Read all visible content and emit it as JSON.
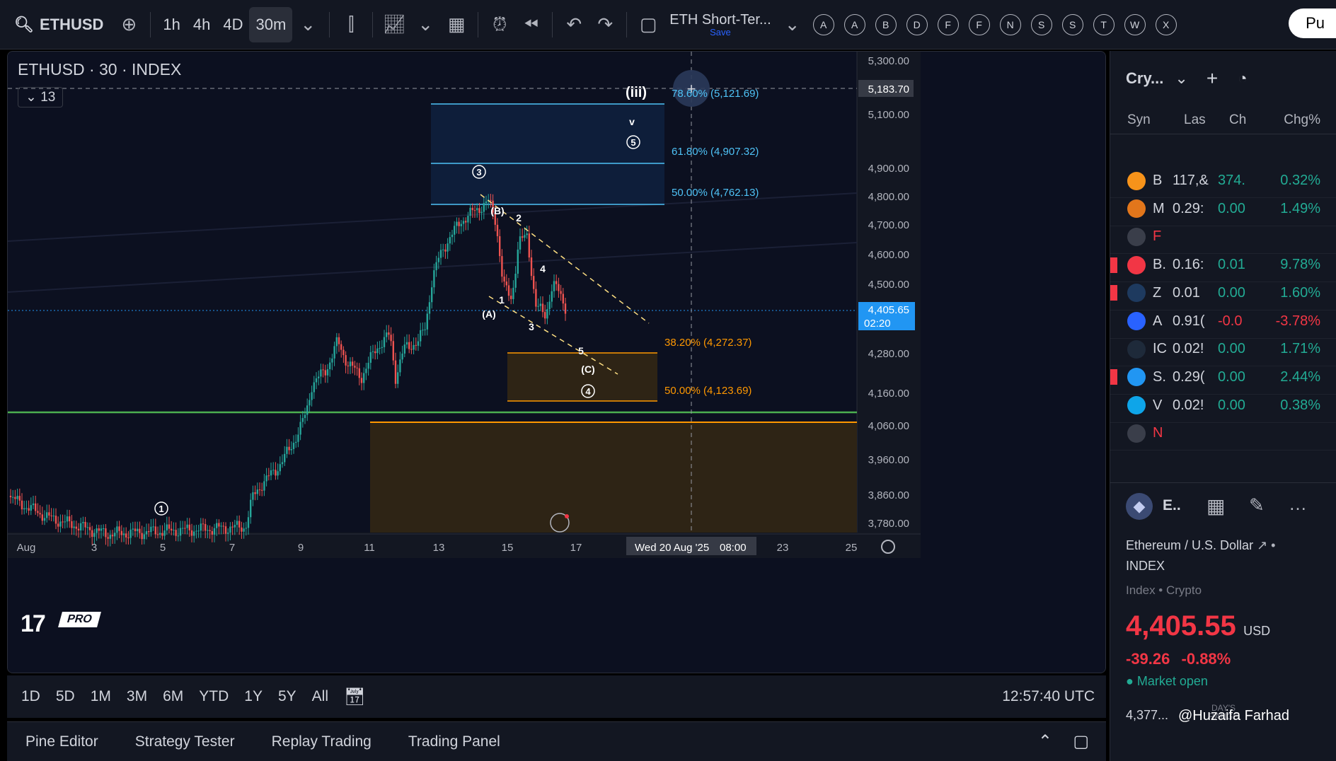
{
  "toolbar": {
    "symbol": "ETHUSD",
    "timeframes": [
      "1h",
      "4h",
      "4D",
      "30m"
    ],
    "active_timeframe": "30m",
    "layout_name": "ETH Short-Ter...",
    "layout_save": "Save",
    "letter_buttons": [
      "A",
      "A",
      "B",
      "D",
      "F",
      "F",
      "N",
      "S",
      "S",
      "T",
      "W",
      "X"
    ],
    "publish_label": "Pu",
    "icons": [
      "search-icon",
      "add-symbol-icon",
      "chevron-down-icon",
      "candles-icon",
      "indicators-icon",
      "layouts-icon",
      "alert-icon",
      "replay-icon",
      "undo-icon",
      "redo-icon",
      "fullscreen-icon"
    ]
  },
  "chart": {
    "title": "ETHUSD · 30 · INDEX",
    "indicator_count": "13",
    "logo_text": "PRO",
    "current_price": "4,405.65",
    "countdown": "02:20",
    "crosshair_price": "5,183.70",
    "crosshair_date": "Wed 20 Aug '25",
    "crosshair_time": "08:00",
    "price_ticks": [
      "5,300.00",
      "5,100.00",
      "4,900.00",
      "4,800.00",
      "4,700.00",
      "4,600.00",
      "4,500.00",
      "4,280.00",
      "4,160.00",
      "4,060.00",
      "3,960.00",
      "3,860.00",
      "3,780.00"
    ],
    "date_ticks": [
      "Aug",
      "3",
      "5",
      "7",
      "9",
      "11",
      "13",
      "15",
      "17",
      "23",
      "25"
    ],
    "fib_levels_upper": [
      "78.60% (5,121.69)",
      "61.80% (4,907.32)",
      "50.00% (4,762.13)"
    ],
    "fib_levels_lower": [
      "38.20% (4,272.37)",
      "50.00% (4,123.69)"
    ],
    "wave_labels": [
      "(iii)",
      "v",
      "5",
      "3",
      "(B)",
      "2",
      "4",
      "1",
      "(A)",
      "3",
      "5",
      "(C)",
      "4",
      "1"
    ],
    "colors": {
      "background": "#0c1020",
      "upper_zone": "#0f2140",
      "upper_line": "#4fc3f7",
      "lower_zone": "#2e2415",
      "lower_line": "#ff9800",
      "support_line": "#4caf50",
      "candle_up": "#26a69a",
      "candle_down": "#ef5350",
      "current_price_bg": "#2196f3"
    }
  },
  "range_bar": {
    "ranges": [
      "1D",
      "5D",
      "1M",
      "3M",
      "6M",
      "YTD",
      "1Y",
      "5Y",
      "All"
    ],
    "clock": "12:57:40 UTC"
  },
  "bottom_tabs": [
    "Pine Editor",
    "Strategy Tester",
    "Replay Trading",
    "Trading Panel"
  ],
  "watchlist": {
    "title": "Cry...",
    "columns": [
      "Syn",
      "Las",
      "Ch",
      "Chg%"
    ],
    "rows": [
      {
        "sym": "B",
        "last": "117,&",
        "ch": "374.",
        "chp": "0.32%",
        "dir": "pos",
        "icon_color": "#f7931a",
        "flag": false
      },
      {
        "sym": "M",
        "last": "0.29:",
        "ch": "0.00",
        "chp": "1.49%",
        "dir": "pos",
        "icon_color": "#e2761b",
        "flag": false
      },
      {
        "sym": "F",
        "last": "",
        "ch": "",
        "chp": "",
        "dir": "neg",
        "icon_color": "#3a3e4a",
        "flag": false
      },
      {
        "sym": "B.",
        "last": "0.16:",
        "ch": "0.01",
        "chp": "9.78%",
        "dir": "pos",
        "icon_color": "#f23645",
        "flag": true
      },
      {
        "sym": "Z",
        "last": "0.01",
        "ch": "0.00",
        "chp": "1.60%",
        "dir": "pos",
        "icon_color": "#1e3a5f",
        "flag": true
      },
      {
        "sym": "A",
        "last": "0.91(",
        "ch": "-0.0",
        "chp": "-3.78%",
        "dir": "neg",
        "icon_color": "#2962ff",
        "flag": false
      },
      {
        "sym": "IC",
        "last": "0.02!",
        "ch": "0.00",
        "chp": "1.71%",
        "dir": "pos",
        "icon_color": "#1e2a3a",
        "flag": false
      },
      {
        "sym": "S.",
        "last": "0.29(",
        "ch": "0.00",
        "chp": "2.44%",
        "dir": "pos",
        "icon_color": "#2196f3",
        "flag": true
      },
      {
        "sym": "V",
        "last": "0.02!",
        "ch": "0.00",
        "chp": "0.38%",
        "dir": "pos",
        "icon_color": "#0ea5e9",
        "flag": false
      },
      {
        "sym": "N",
        "last": "",
        "ch": "",
        "chp": "",
        "dir": "neg",
        "icon_color": "#3a3e4a",
        "flag": false
      }
    ]
  },
  "details": {
    "symbol": "E..",
    "name": "Ethereum / U.S. Dollar",
    "exchange": "INDEX",
    "type": "Index • Crypto",
    "price": "4,405.55",
    "currency": "USD",
    "change": "-39.26",
    "change_pct": "-0.88%",
    "status": "Market open",
    "range_low": "4,377...",
    "range_label": "DAY'S RANGE",
    "watermark": "@Huzaifa Farhad"
  }
}
